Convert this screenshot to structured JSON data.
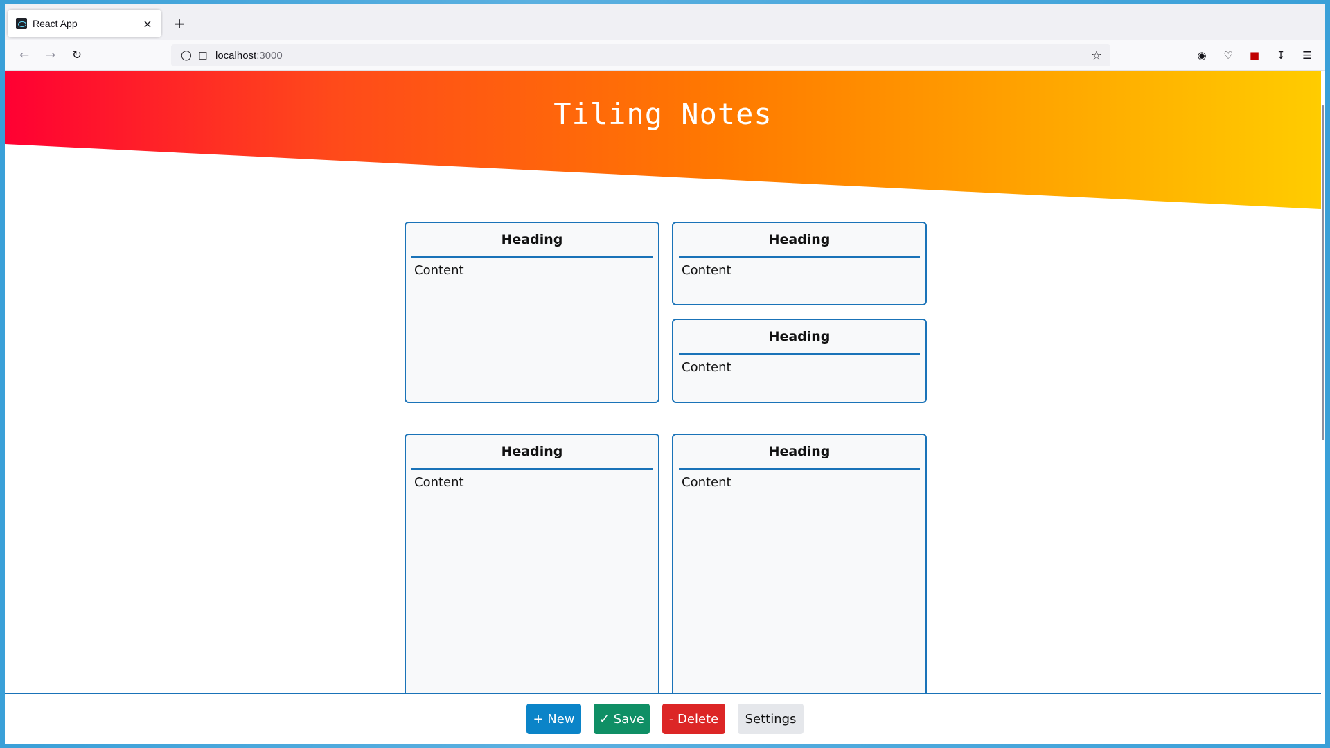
{
  "browser": {
    "tab_title": "React App",
    "tab_close": "×",
    "new_tab": "+",
    "url_host": "localhost",
    "url_port": ":3000"
  },
  "app": {
    "title": "Tiling Notes"
  },
  "notes": [
    {
      "heading": "Heading",
      "content": "Content"
    },
    {
      "heading": "Heading",
      "content": "Content"
    },
    {
      "heading": "Heading",
      "content": "Content"
    },
    {
      "heading": "Heading",
      "content": "Content"
    },
    {
      "heading": "Heading",
      "content": "Content"
    }
  ],
  "toolbar": {
    "new_label": "+ New",
    "save_label": "✓ Save",
    "delete_label": "- Delete",
    "settings_label": "Settings"
  },
  "colors": {
    "accent": "#1a73b8",
    "new": "#0b84c8",
    "save": "#0f8f65",
    "delete": "#dc2626",
    "settings": "#e5e7eb"
  }
}
